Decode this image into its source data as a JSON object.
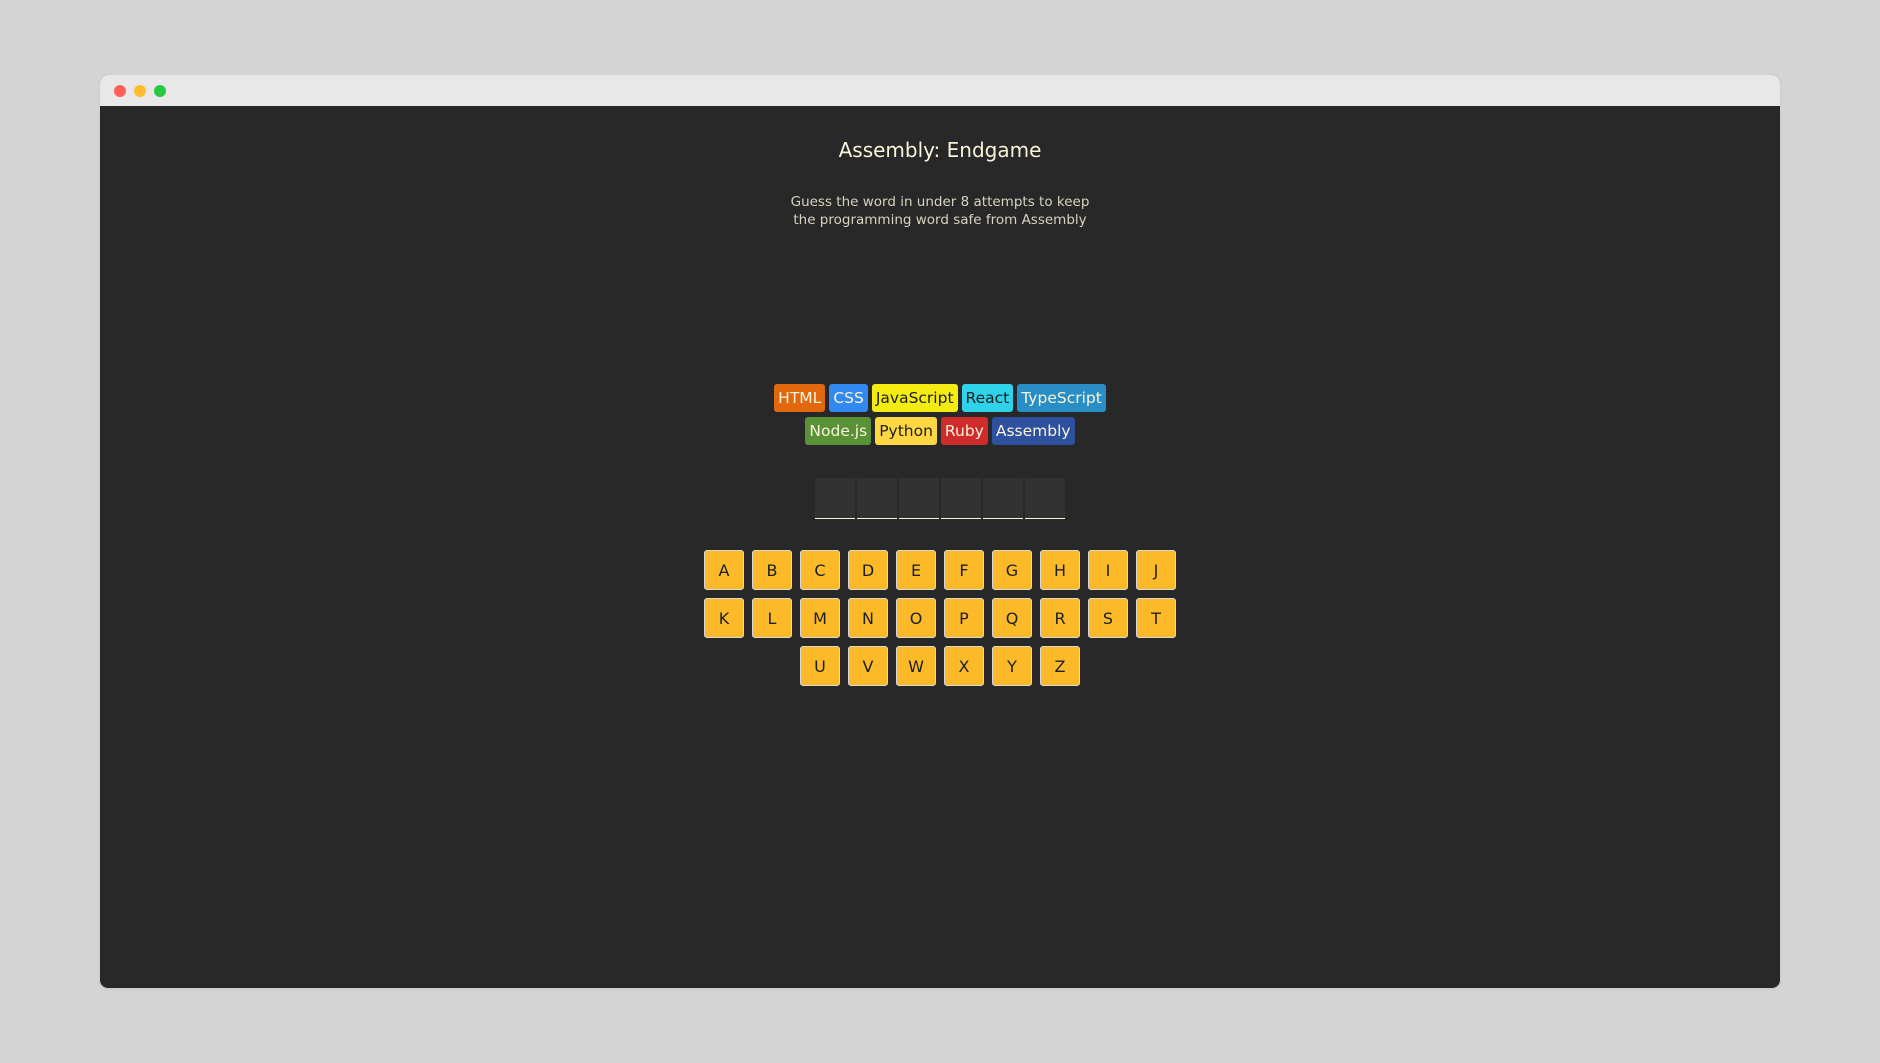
{
  "window": {
    "controls": [
      "close",
      "minimize",
      "maximize"
    ]
  },
  "header": {
    "title": "Assembly: Endgame",
    "subtitle": "Guess the word in under 8 attempts to keep the programming word safe from Assembly"
  },
  "languages": [
    {
      "name": "HTML",
      "backgroundColor": "#E2680F",
      "color": "#F9F4DA"
    },
    {
      "name": "CSS",
      "backgroundColor": "#328AF1",
      "color": "#F9F4DA"
    },
    {
      "name": "JavaScript",
      "backgroundColor": "#F4EB13",
      "color": "#1E1E1E"
    },
    {
      "name": "React",
      "backgroundColor": "#2ED3E9",
      "color": "#1E1E1E"
    },
    {
      "name": "TypeScript",
      "backgroundColor": "#298EC6",
      "color": "#F9F4DA"
    },
    {
      "name": "Node.js",
      "backgroundColor": "#599137",
      "color": "#F9F4DA"
    },
    {
      "name": "Python",
      "backgroundColor": "#FFD742",
      "color": "#1E1E1E"
    },
    {
      "name": "Ruby",
      "backgroundColor": "#D02B2B",
      "color": "#F9F4DA"
    },
    {
      "name": "Assembly",
      "backgroundColor": "#2D519F",
      "color": "#F9F4DA"
    }
  ],
  "word": {
    "letters": [
      "",
      "",
      "",
      "",
      "",
      ""
    ]
  },
  "keyboard": {
    "keys": [
      "A",
      "B",
      "C",
      "D",
      "E",
      "F",
      "G",
      "H",
      "I",
      "J",
      "K",
      "L",
      "M",
      "N",
      "O",
      "P",
      "Q",
      "R",
      "S",
      "T",
      "U",
      "V",
      "W",
      "X",
      "Y",
      "Z"
    ],
    "keyColor": "#FCBA29"
  }
}
